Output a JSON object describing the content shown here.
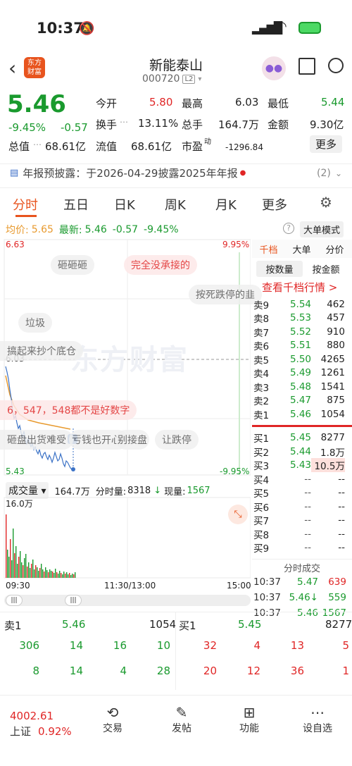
{
  "status": {
    "time": "10:37"
  },
  "header": {
    "name": "新能泰山",
    "code": "000720",
    "level": "L2"
  },
  "quote": {
    "price": "5.46",
    "change_pct": "-9.45%",
    "change": "-0.57",
    "open_label": "今开",
    "open": "5.80",
    "high_label": "最高",
    "high": "6.03",
    "low_label": "最低",
    "low": "5.44",
    "turnover_label": "换手",
    "turnover": "13.11%",
    "volume_label": "总手",
    "volume": "164.7万",
    "amount_label": "金额",
    "amount": "9.30亿",
    "mktcap_label": "总值",
    "mktcap": "68.61亿",
    "float_label": "流值",
    "float": "68.61亿",
    "pe_label": "市盈",
    "pe_sup": "动",
    "pe": "-1296.84",
    "more": "更多"
  },
  "notice": {
    "text": "年报预披露：于2026-04-29披露2025年年报",
    "count": "(2)"
  },
  "tabs": [
    "分时",
    "五日",
    "日K",
    "周K",
    "月K",
    "更多"
  ],
  "chart": {
    "avg_label": "均价:",
    "avg": "5.65",
    "latest_label": "最新:",
    "latest": "5.46",
    "latest_chg": "-0.57",
    "latest_pct": "-9.45%",
    "big_order": "大单模式",
    "y_top": "6.63",
    "y_mid": "6.03",
    "y_bot": "5.43",
    "pct_top": "9.95%",
    "pct_bot": "-9.95%",
    "vol_label": "成交量",
    "vol_total": "164.7万",
    "fs_vol_label": "分时量:",
    "fs_vol": "8318",
    "cur_vol_label": "现量:",
    "cur_vol": "1567",
    "vol_max": "16.0万",
    "t_start": "09:30",
    "t_mid": "11:30/13:00",
    "t_end": "15:00",
    "watermark": "东方财富",
    "danmu": [
      "砸砸砸",
      "完全没承接的",
      "按死跌停的韭",
      "垃圾",
      "搞起来抄个底仓",
      "6，547，548都不是好数字",
      "砸盘出货难受",
      "亏钱也开心",
      "别接盘",
      "让跌停"
    ]
  },
  "book": {
    "tabs": [
      "千档",
      "大单",
      "分价"
    ],
    "sub": [
      "按数量",
      "按金额"
    ],
    "link": "查看千档行情 >",
    "asks": [
      {
        "l": "卖9",
        "p": "5.54",
        "v": "462"
      },
      {
        "l": "卖8",
        "p": "5.53",
        "v": "457"
      },
      {
        "l": "卖7",
        "p": "5.52",
        "v": "910"
      },
      {
        "l": "卖6",
        "p": "5.51",
        "v": "880"
      },
      {
        "l": "卖5",
        "p": "5.50",
        "v": "4265"
      },
      {
        "l": "卖4",
        "p": "5.49",
        "v": "1261"
      },
      {
        "l": "卖3",
        "p": "5.48",
        "v": "1541"
      },
      {
        "l": "卖2",
        "p": "5.47",
        "v": "875"
      },
      {
        "l": "卖1",
        "p": "5.46",
        "v": "1054"
      }
    ],
    "bids": [
      {
        "l": "买1",
        "p": "5.45",
        "v": "8277"
      },
      {
        "l": "买2",
        "p": "5.44",
        "v": "1.8万"
      },
      {
        "l": "买3",
        "p": "5.43",
        "v": "10.5万"
      },
      {
        "l": "买4",
        "p": "--",
        "v": "--"
      },
      {
        "l": "买5",
        "p": "--",
        "v": "--"
      },
      {
        "l": "买6",
        "p": "--",
        "v": "--"
      },
      {
        "l": "买7",
        "p": "--",
        "v": "--"
      },
      {
        "l": "买8",
        "p": "--",
        "v": "--"
      },
      {
        "l": "买9",
        "p": "--",
        "v": "--"
      }
    ],
    "trade_title": "分时成交",
    "trades": [
      {
        "t": "10:37",
        "p": "5.47",
        "v": "639"
      },
      {
        "t": "10:37",
        "p": "5.46↓",
        "v": "559"
      },
      {
        "t": "10:37",
        "p": "5.46",
        "v": "1567"
      }
    ]
  },
  "level": {
    "sell_label": "卖1",
    "sell_price": "5.46",
    "sell_vol": "1054",
    "buy_label": "买1",
    "buy_price": "5.45",
    "buy_vol": "8277",
    "sell_q1": [
      "306",
      "14",
      "16",
      "10"
    ],
    "sell_q2": [
      "8",
      "14",
      "4",
      "28"
    ],
    "buy_q1": [
      "32",
      "4",
      "13",
      "5"
    ],
    "buy_q2": [
      "20",
      "12",
      "36",
      "1"
    ]
  },
  "bottom": {
    "index_value": "4002.61",
    "index_name": "上证",
    "index_pct": "0.92%",
    "tabs": [
      "交易",
      "发帖",
      "功能",
      "设自选"
    ]
  }
}
